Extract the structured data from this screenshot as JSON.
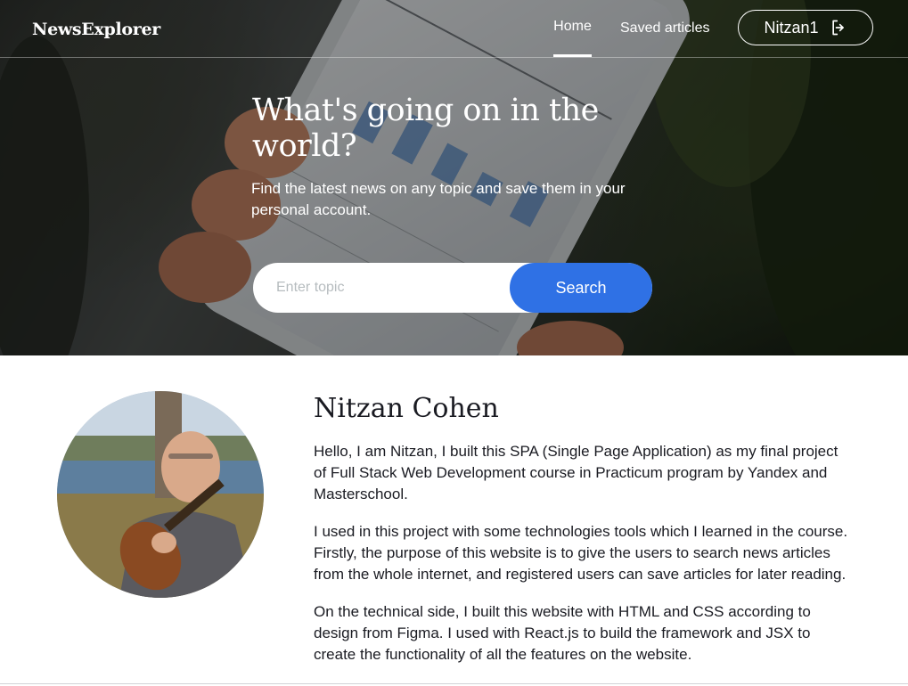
{
  "header": {
    "logo": "NewsExplorer",
    "nav": {
      "home": "Home",
      "saved": "Saved articles"
    },
    "user_button_label": "Nitzan1"
  },
  "hero": {
    "title": "What's going on in the world?",
    "subtitle": "Find the latest news on any topic and save them in your personal account.",
    "search": {
      "placeholder": "Enter topic",
      "value": "",
      "button_label": "Search"
    }
  },
  "about": {
    "name": "Nitzan Cohen",
    "paragraphs": [
      "Hello, I am Nitzan, I built this SPA (Single Page Application) as my final project of Full Stack Web Development course in Practicum program by Yandex and Masterschool.",
      "I used in this project with some technologies tools which I learned in the course. Firstly, the purpose of this website is to give the users to search news articles from the whole internet, and registered users can save articles for later reading.",
      "On the technical side, I built this website with HTML and CSS according to design from Figma. I used with React.js to build the framework and JSX to create the functionality of all the features on the website."
    ]
  },
  "colors": {
    "accent": "#2f71e5",
    "text": "#1a1b22",
    "placeholder": "#b6bcbf"
  },
  "icons": {
    "logout": "logout-icon"
  }
}
